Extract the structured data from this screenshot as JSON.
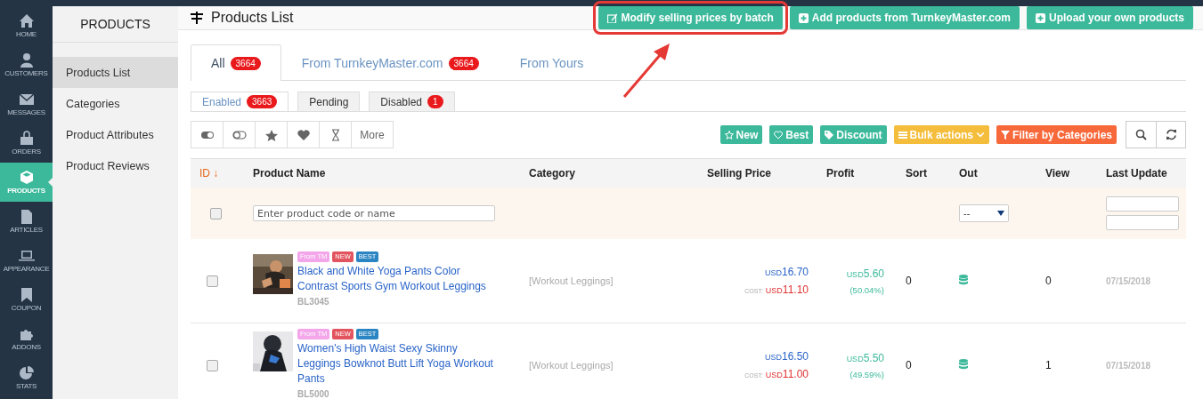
{
  "nav": [
    {
      "label": "HOME",
      "selected": false
    },
    {
      "label": "CUSTOMERS",
      "selected": false
    },
    {
      "label": "MESSAGES",
      "selected": false
    },
    {
      "label": "ORDERS",
      "selected": false
    },
    {
      "label": "PRODUCTS",
      "selected": true
    },
    {
      "label": "ARTICLES",
      "selected": false
    },
    {
      "label": "APPEARANCE",
      "selected": false
    },
    {
      "label": "COUPON",
      "selected": false
    },
    {
      "label": "ADDONS",
      "selected": false
    },
    {
      "label": "STATS",
      "selected": false
    }
  ],
  "submenu": {
    "title": "PRODUCTS",
    "items": [
      {
        "label": "Products List",
        "selected": true
      },
      {
        "label": "Categories",
        "selected": false
      },
      {
        "label": "Product Attributes",
        "selected": false
      },
      {
        "label": "Product Reviews",
        "selected": false
      }
    ]
  },
  "header": {
    "title": "Products List",
    "buttons": [
      {
        "label": "Modify selling prices by batch",
        "highlighted": true
      },
      {
        "label": "Add products from TurnkeyMaster.com",
        "highlighted": false
      },
      {
        "label": "Upload your own products",
        "highlighted": false
      }
    ]
  },
  "tabs": [
    {
      "label": "All",
      "count": "3664",
      "selected": true
    },
    {
      "label": "From TurnkeyMaster.com",
      "count": "3664",
      "selected": false
    },
    {
      "label": "From Yours",
      "selected": false
    }
  ],
  "status_tabs": [
    {
      "label": "Enabled",
      "count": "3663",
      "selected": true
    },
    {
      "label": "Pending",
      "selected": false
    },
    {
      "label": "Disabled",
      "count": "1",
      "selected": false
    }
  ],
  "toolbar": {
    "more_label": "More",
    "actions": [
      {
        "label": "New",
        "color": "#3cb99b",
        "kind": "button"
      },
      {
        "label": "Best",
        "color": "#3cb99b",
        "kind": "button"
      },
      {
        "label": "Discount",
        "color": "#3cb99b",
        "kind": "button"
      },
      {
        "label": "Bulk actions",
        "color": "#f5bd3c",
        "kind": "dropdown"
      },
      {
        "label": "Filter by Categories",
        "color": "#f7683a",
        "kind": "button"
      }
    ]
  },
  "table": {
    "columns": [
      {
        "label": "ID",
        "sort_mark": "↓"
      },
      {
        "label": "Product Name"
      },
      {
        "label": "Category"
      },
      {
        "label": "Selling Price"
      },
      {
        "label": "Profit"
      },
      {
        "label": "Sort"
      },
      {
        "label": "Out"
      },
      {
        "label": "View"
      },
      {
        "label": "Last Update"
      }
    ],
    "filter": {
      "select_all_checked": false,
      "search_placeholder": "Enter product code or name",
      "out_value": "--"
    },
    "rows": [
      {
        "checked": false,
        "tags": [
          {
            "label": "From TM",
            "color": "#f3a6ea"
          },
          {
            "label": "NEW",
            "color": "#e2545e"
          },
          {
            "label": "BEST",
            "color": "#2b85c2"
          }
        ],
        "name": "Black and White Yoga Pants Color Contrast Sports Gym Workout Leggings",
        "sku": "BL3045",
        "category": "[Workout Leggings]",
        "price_currency": "USD",
        "price": "16.70",
        "cost_label": "COST:",
        "cost_currency": "USD",
        "cost": "11.10",
        "profit_currency": "USD",
        "profit": "5.60",
        "profit_pct": "(50.04%)",
        "sort": "0",
        "view": "0",
        "updated": "07/15/2018"
      },
      {
        "checked": false,
        "tags": [
          {
            "label": "From TM",
            "color": "#f3a6ea"
          },
          {
            "label": "NEW",
            "color": "#e2545e"
          },
          {
            "label": "BEST",
            "color": "#2b85c2"
          }
        ],
        "name": "Women's High Waist Sexy Skinny Leggings Bowknot Butt Lift Yoga Workout Pants",
        "sku": "BL5000",
        "category": "[Workout Leggings]",
        "price_currency": "USD",
        "price": "16.50",
        "cost_label": "COST:",
        "cost_currency": "USD",
        "cost": "11.00",
        "profit_currency": "USD",
        "profit": "5.50",
        "profit_pct": "(49.59%)",
        "sort": "0",
        "view": "1",
        "updated": "07/15/2018"
      }
    ]
  }
}
